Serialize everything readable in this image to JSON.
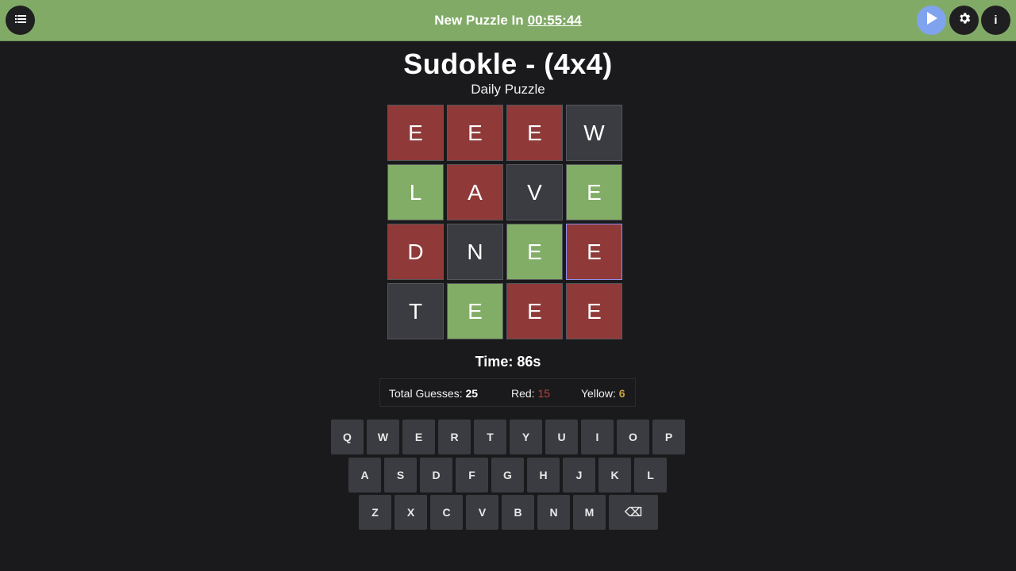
{
  "header": {
    "countdown_label": "New Puzzle In",
    "countdown_time": "00:55:44",
    "icons": [
      "list-icon",
      "play-icon",
      "gear-icon",
      "info-icon"
    ],
    "info_glyph": "i"
  },
  "title": "Sudokle - (4x4)",
  "subtitle": "Daily Puzzle",
  "colors": {
    "red": "#8f3a39",
    "green": "#82ad67",
    "gray": "#3b3c41",
    "header": "#82aa67",
    "selected_border": "#8d8ff0"
  },
  "grid": [
    [
      {
        "letter": "E",
        "state": "red"
      },
      {
        "letter": "E",
        "state": "red"
      },
      {
        "letter": "E",
        "state": "red"
      },
      {
        "letter": "W",
        "state": "gray"
      }
    ],
    [
      {
        "letter": "L",
        "state": "green"
      },
      {
        "letter": "A",
        "state": "red"
      },
      {
        "letter": "V",
        "state": "gray"
      },
      {
        "letter": "E",
        "state": "green"
      }
    ],
    [
      {
        "letter": "D",
        "state": "red"
      },
      {
        "letter": "N",
        "state": "gray"
      },
      {
        "letter": "E",
        "state": "green"
      },
      {
        "letter": "E",
        "state": "red",
        "selected": true
      }
    ],
    [
      {
        "letter": "T",
        "state": "gray"
      },
      {
        "letter": "E",
        "state": "green"
      },
      {
        "letter": "E",
        "state": "red"
      },
      {
        "letter": "E",
        "state": "red"
      }
    ]
  ],
  "time_text": "Time: 86s",
  "stats": {
    "total_label": "Total Guesses:",
    "total_value": "25",
    "red_label": "Red:",
    "red_value": "15",
    "yellow_label": "Yellow:",
    "yellow_value": "6"
  },
  "keyboard": {
    "rows": [
      [
        "Q",
        "W",
        "E",
        "R",
        "T",
        "Y",
        "U",
        "I",
        "O",
        "P"
      ],
      [
        "A",
        "S",
        "D",
        "F",
        "G",
        "H",
        "J",
        "K",
        "L"
      ],
      [
        "Z",
        "X",
        "C",
        "V",
        "B",
        "N",
        "M",
        "⌫"
      ]
    ]
  }
}
